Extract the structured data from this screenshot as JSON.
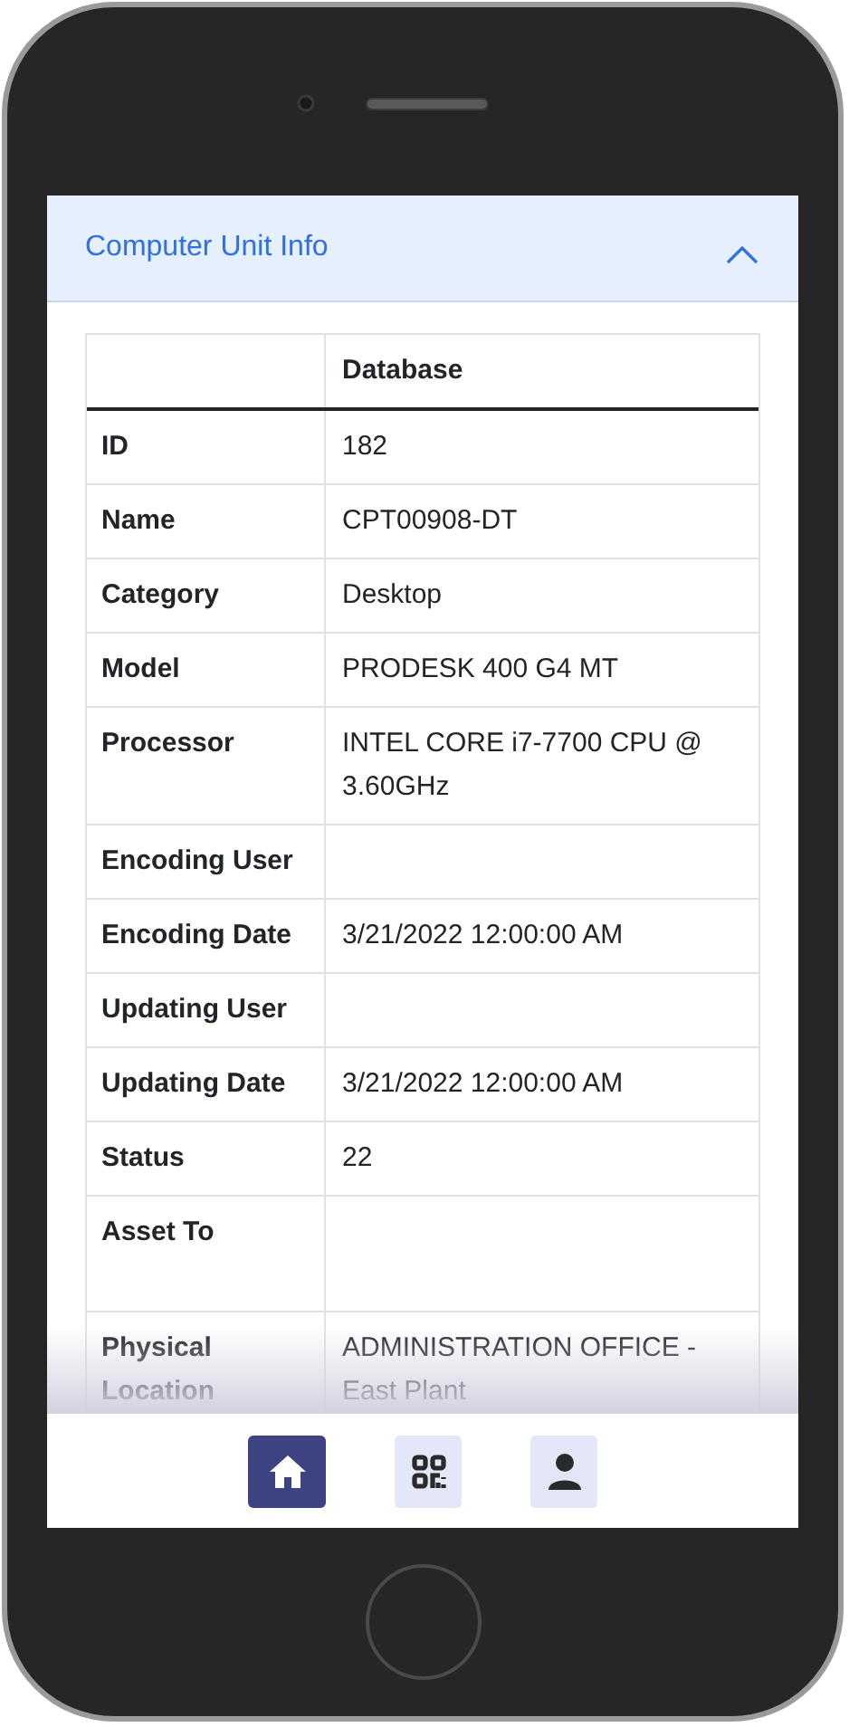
{
  "accordion": {
    "title": "Computer Unit Info",
    "expanded": true
  },
  "table": {
    "columns": [
      "Database"
    ],
    "rows": [
      {
        "label": "ID",
        "value": "182"
      },
      {
        "label": "Name",
        "value": "CPT00908-DT"
      },
      {
        "label": "Category",
        "value": "Desktop"
      },
      {
        "label": "Model",
        "value": "PRODESK 400 G4 MT"
      },
      {
        "label": "Processor",
        "value": "INTEL CORE i7-7700 CPU @ 3.60GHz"
      },
      {
        "label": "Encoding User"
      },
      {
        "label": "Encoding Date",
        "value": "3/21/2022 12:00:00 AM"
      },
      {
        "label": "Updating User"
      },
      {
        "label": "Updating Date",
        "value": "3/21/2022 12:00:00 AM"
      },
      {
        "label": "Status",
        "value": "22"
      },
      {
        "label": "Asset To"
      },
      {
        "label": "Physical Location",
        "value": "ADMINISTRATION OFFICE - East Plant"
      }
    ]
  },
  "nav": [
    {
      "kind": "home",
      "selected": true
    },
    {
      "kind": "qr",
      "selected": false
    },
    {
      "kind": "profile",
      "selected": false
    }
  ]
}
